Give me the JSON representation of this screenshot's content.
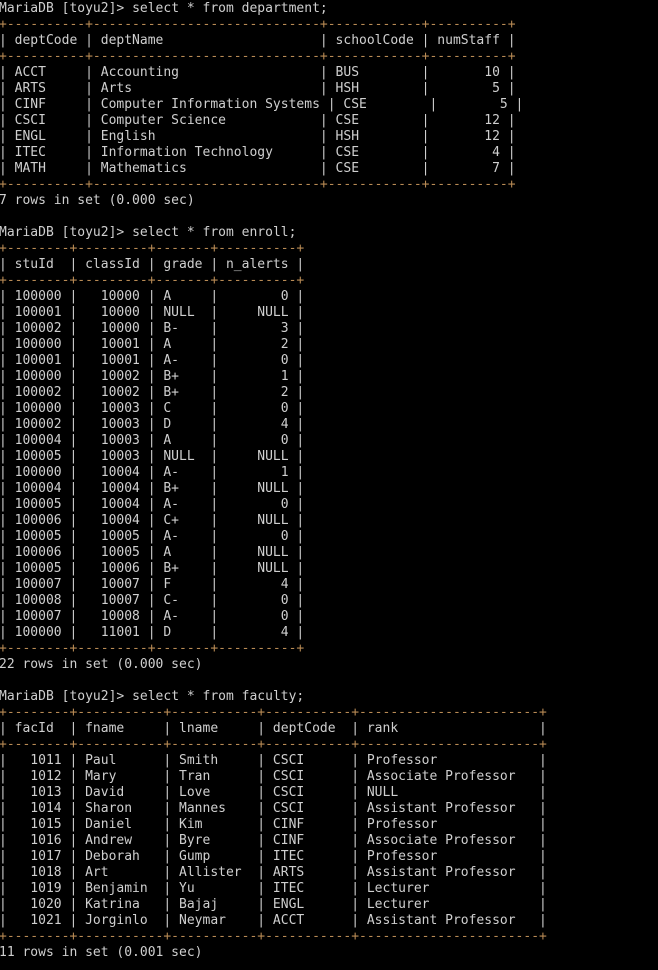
{
  "terminal": {
    "prompt": "MariaDB [toyu2]> ",
    "colors": {
      "background": "#000000",
      "foreground": "#cfcfcf",
      "rule": "#b98b55"
    }
  },
  "blocks": [
    {
      "id": "department",
      "command": "select * from department;",
      "columns": [
        {
          "name": "deptCode",
          "width": 8,
          "align": "left"
        },
        {
          "name": "deptName",
          "width": 27,
          "align": "left"
        },
        {
          "name": "schoolCode",
          "width": 10,
          "align": "left"
        },
        {
          "name": "numStaff",
          "width": 8,
          "align": "right"
        }
      ],
      "rows": [
        [
          "ACCT",
          "Accounting",
          "BUS",
          "10"
        ],
        [
          "ARTS",
          "Arts",
          "HSH",
          "5"
        ],
        [
          "CINF",
          "Computer Information Systems",
          "CSE",
          "5"
        ],
        [
          "CSCI",
          "Computer Science",
          "CSE",
          "12"
        ],
        [
          "ENGL",
          "English",
          "HSH",
          "12"
        ],
        [
          "ITEC",
          "Information Technology",
          "CSE",
          "4"
        ],
        [
          "MATH",
          "Mathematics",
          "CSE",
          "7"
        ]
      ],
      "status": "7 rows in set (0.000 sec)"
    },
    {
      "id": "enroll",
      "command": "select * from enroll;",
      "columns": [
        {
          "name": "stuId",
          "width": 6,
          "align": "right"
        },
        {
          "name": "classId",
          "width": 7,
          "align": "right"
        },
        {
          "name": "grade",
          "width": 5,
          "align": "left"
        },
        {
          "name": "n_alerts",
          "width": 8,
          "align": "right"
        }
      ],
      "rows": [
        [
          "100000",
          "10000",
          "A",
          "0"
        ],
        [
          "100001",
          "10000",
          "NULL",
          "NULL"
        ],
        [
          "100002",
          "10000",
          "B-",
          "3"
        ],
        [
          "100000",
          "10001",
          "A",
          "2"
        ],
        [
          "100001",
          "10001",
          "A-",
          "0"
        ],
        [
          "100000",
          "10002",
          "B+",
          "1"
        ],
        [
          "100002",
          "10002",
          "B+",
          "2"
        ],
        [
          "100000",
          "10003",
          "C",
          "0"
        ],
        [
          "100002",
          "10003",
          "D",
          "4"
        ],
        [
          "100004",
          "10003",
          "A",
          "0"
        ],
        [
          "100005",
          "10003",
          "NULL",
          "NULL"
        ],
        [
          "100000",
          "10004",
          "A-",
          "1"
        ],
        [
          "100004",
          "10004",
          "B+",
          "NULL"
        ],
        [
          "100005",
          "10004",
          "A-",
          "0"
        ],
        [
          "100006",
          "10004",
          "C+",
          "NULL"
        ],
        [
          "100005",
          "10005",
          "A-",
          "0"
        ],
        [
          "100006",
          "10005",
          "A",
          "NULL"
        ],
        [
          "100005",
          "10006",
          "B+",
          "NULL"
        ],
        [
          "100007",
          "10007",
          "F",
          "4"
        ],
        [
          "100008",
          "10007",
          "C-",
          "0"
        ],
        [
          "100007",
          "10008",
          "A-",
          "0"
        ],
        [
          "100000",
          "11001",
          "D",
          "4"
        ]
      ],
      "status": "22 rows in set (0.000 sec)"
    },
    {
      "id": "faculty",
      "command": "select * from faculty;",
      "columns": [
        {
          "name": "facId",
          "width": 6,
          "align": "right"
        },
        {
          "name": "fname",
          "width": 9,
          "align": "left"
        },
        {
          "name": "lname",
          "width": 9,
          "align": "left"
        },
        {
          "name": "deptCode",
          "width": 9,
          "align": "left"
        },
        {
          "name": "rank",
          "width": 21,
          "align": "left"
        }
      ],
      "rows": [
        [
          "1011",
          "Paul",
          "Smith",
          "CSCI",
          "Professor"
        ],
        [
          "1012",
          "Mary",
          "Tran",
          "CSCI",
          "Associate Professor"
        ],
        [
          "1013",
          "David",
          "Love",
          "CSCI",
          "NULL"
        ],
        [
          "1014",
          "Sharon",
          "Mannes",
          "CSCI",
          "Assistant Professor"
        ],
        [
          "1015",
          "Daniel",
          "Kim",
          "CINF",
          "Professor"
        ],
        [
          "1016",
          "Andrew",
          "Byre",
          "CINF",
          "Associate Professor"
        ],
        [
          "1017",
          "Deborah",
          "Gump",
          "ITEC",
          "Professor"
        ],
        [
          "1018",
          "Art",
          "Allister",
          "ARTS",
          "Assistant Professor"
        ],
        [
          "1019",
          "Benjamin",
          "Yu",
          "ITEC",
          "Lecturer"
        ],
        [
          "1020",
          "Katrina",
          "Bajaj",
          "ENGL",
          "Lecturer"
        ],
        [
          "1021",
          "Jorginlo",
          "Neymar",
          "ACCT",
          "Assistant Professor"
        ]
      ],
      "status": "11 rows in set (0.001 sec)"
    }
  ]
}
